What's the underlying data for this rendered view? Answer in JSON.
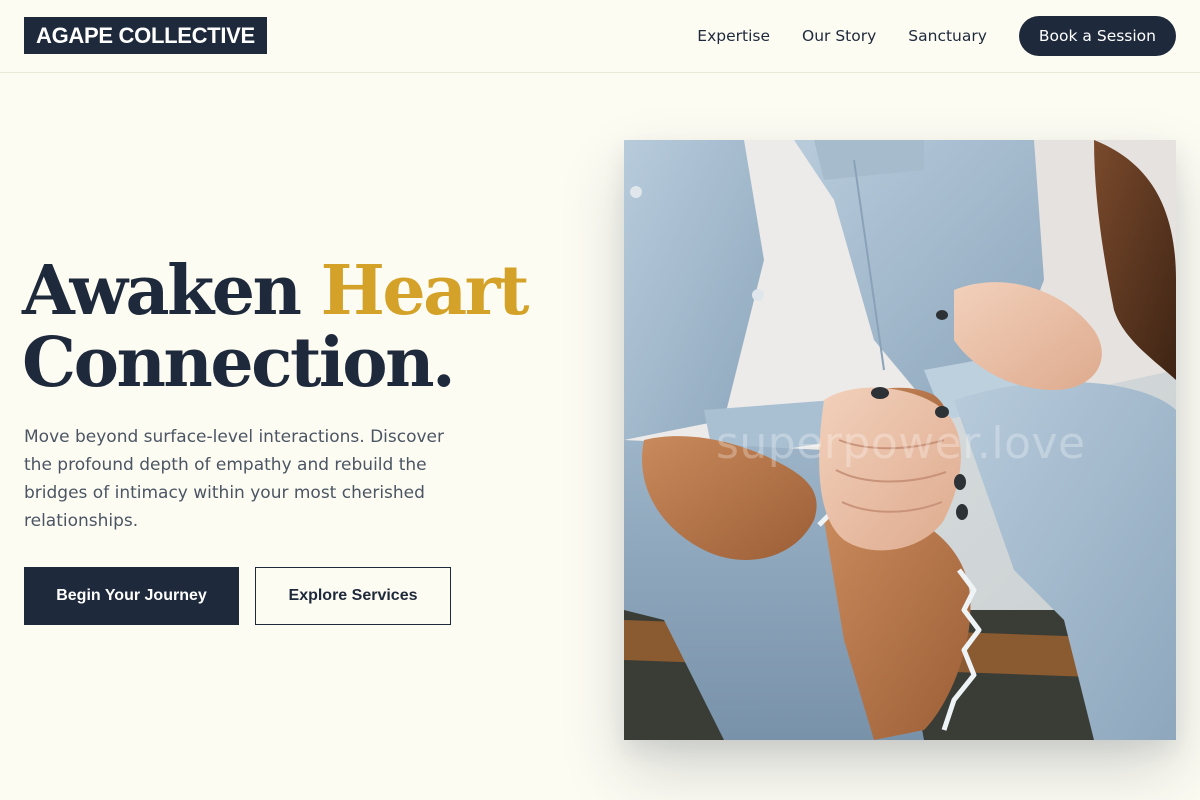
{
  "header": {
    "logo": "AGAPE COLLECTIVE",
    "nav": [
      {
        "label": "Expertise"
      },
      {
        "label": "Our Story"
      },
      {
        "label": "Sanctuary"
      }
    ],
    "cta_label": "Book a Session"
  },
  "hero": {
    "title_part1": "Awaken ",
    "title_accent": "Heart",
    "title_line2": "Connection.",
    "description": "Move beyond surface-level interactions. Discover the profound depth of empathy and rebuild the bridges of intimacy within your most cherished relationships.",
    "primary_button": "Begin Your Journey",
    "secondary_button": "Explore Services",
    "image_watermark": "superpower.love"
  },
  "colors": {
    "navy": "#1e293b",
    "gold_accent": "#d4a228",
    "background": "#fdfcf3",
    "body_text": "#4b5563"
  }
}
